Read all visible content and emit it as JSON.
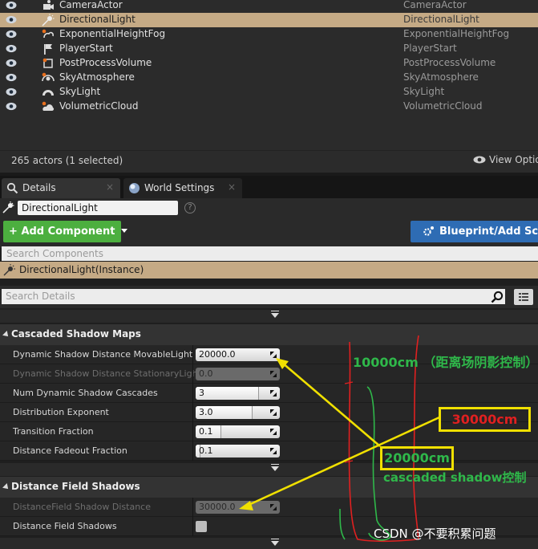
{
  "outliner": {
    "rows": [
      {
        "name": "CameraActor",
        "type": "CameraActor",
        "selected": false,
        "icon": "camera-icon"
      },
      {
        "name": "DirectionalLight",
        "type": "DirectionalLight",
        "selected": true,
        "icon": "sun-icon"
      },
      {
        "name": "ExponentialHeightFog",
        "type": "ExponentialHeightFog",
        "selected": false,
        "icon": "fog-icon"
      },
      {
        "name": "PlayerStart",
        "type": "PlayerStart",
        "selected": false,
        "icon": "flag-icon"
      },
      {
        "name": "PostProcessVolume",
        "type": "PostProcessVolume",
        "selected": false,
        "icon": "volume-icon"
      },
      {
        "name": "SkyAtmosphere",
        "type": "SkyAtmosphere",
        "selected": false,
        "icon": "atmosphere-icon"
      },
      {
        "name": "SkyLight",
        "type": "SkyLight",
        "selected": false,
        "icon": "skylight-icon"
      },
      {
        "name": "VolumetricCloud",
        "type": "VolumetricCloud",
        "selected": false,
        "icon": "cloud-icon"
      }
    ],
    "actor_count": "265 actors (1 selected)",
    "view_options": "View Options"
  },
  "tabs": {
    "details": "Details",
    "world_settings": "World Settings",
    "close": "×"
  },
  "details": {
    "actor_name": "DirectionalLight",
    "help": "?",
    "add_component": "Add Component",
    "add_component_prefix": "+",
    "blueprint_script": "Blueprint/Add Script",
    "search_components_placeholder": "Search Components",
    "component_instance": "DirectionalLight(Instance)",
    "search_details_placeholder": "Search Details"
  },
  "cascaded_shadow_maps": {
    "title": "Cascaded Shadow Maps",
    "props": [
      {
        "label": "Dynamic Shadow Distance MovableLight",
        "value": "20000.0",
        "slider": null,
        "enabled": true
      },
      {
        "label": "Dynamic Shadow Distance StationaryLight",
        "value": "0.0",
        "slider": null,
        "enabled": false
      },
      {
        "label": "Num Dynamic Shadow Cascades",
        "value": "3",
        "slider": 0.75,
        "enabled": true
      },
      {
        "label": "Distribution Exponent",
        "value": "3.0",
        "slider": 0.68,
        "enabled": true
      },
      {
        "label": "Transition Fraction",
        "value": "0.1",
        "slider": 0.3,
        "enabled": true
      },
      {
        "label": "Distance Fadeout Fraction",
        "value": "0.1",
        "slider": 0.06,
        "enabled": true
      }
    ]
  },
  "distance_field_shadows": {
    "title": "Distance Field Shadows",
    "props": [
      {
        "label": "DistanceField Shadow Distance",
        "value": "30000.0",
        "enabled": false
      },
      {
        "label": "Distance Field Shadows",
        "checkbox": true
      }
    ]
  },
  "annotations": {
    "a10000": "10000cm （距离场阴影控制）",
    "a30000": "30000cm",
    "a20000": "20000cm",
    "cascaded": "cascaded shadow控制",
    "watermark": "CSDN @不要积累问题",
    "colors": {
      "green": "#2fb84a",
      "red": "#e02020",
      "yellow": "#f0e000"
    }
  }
}
